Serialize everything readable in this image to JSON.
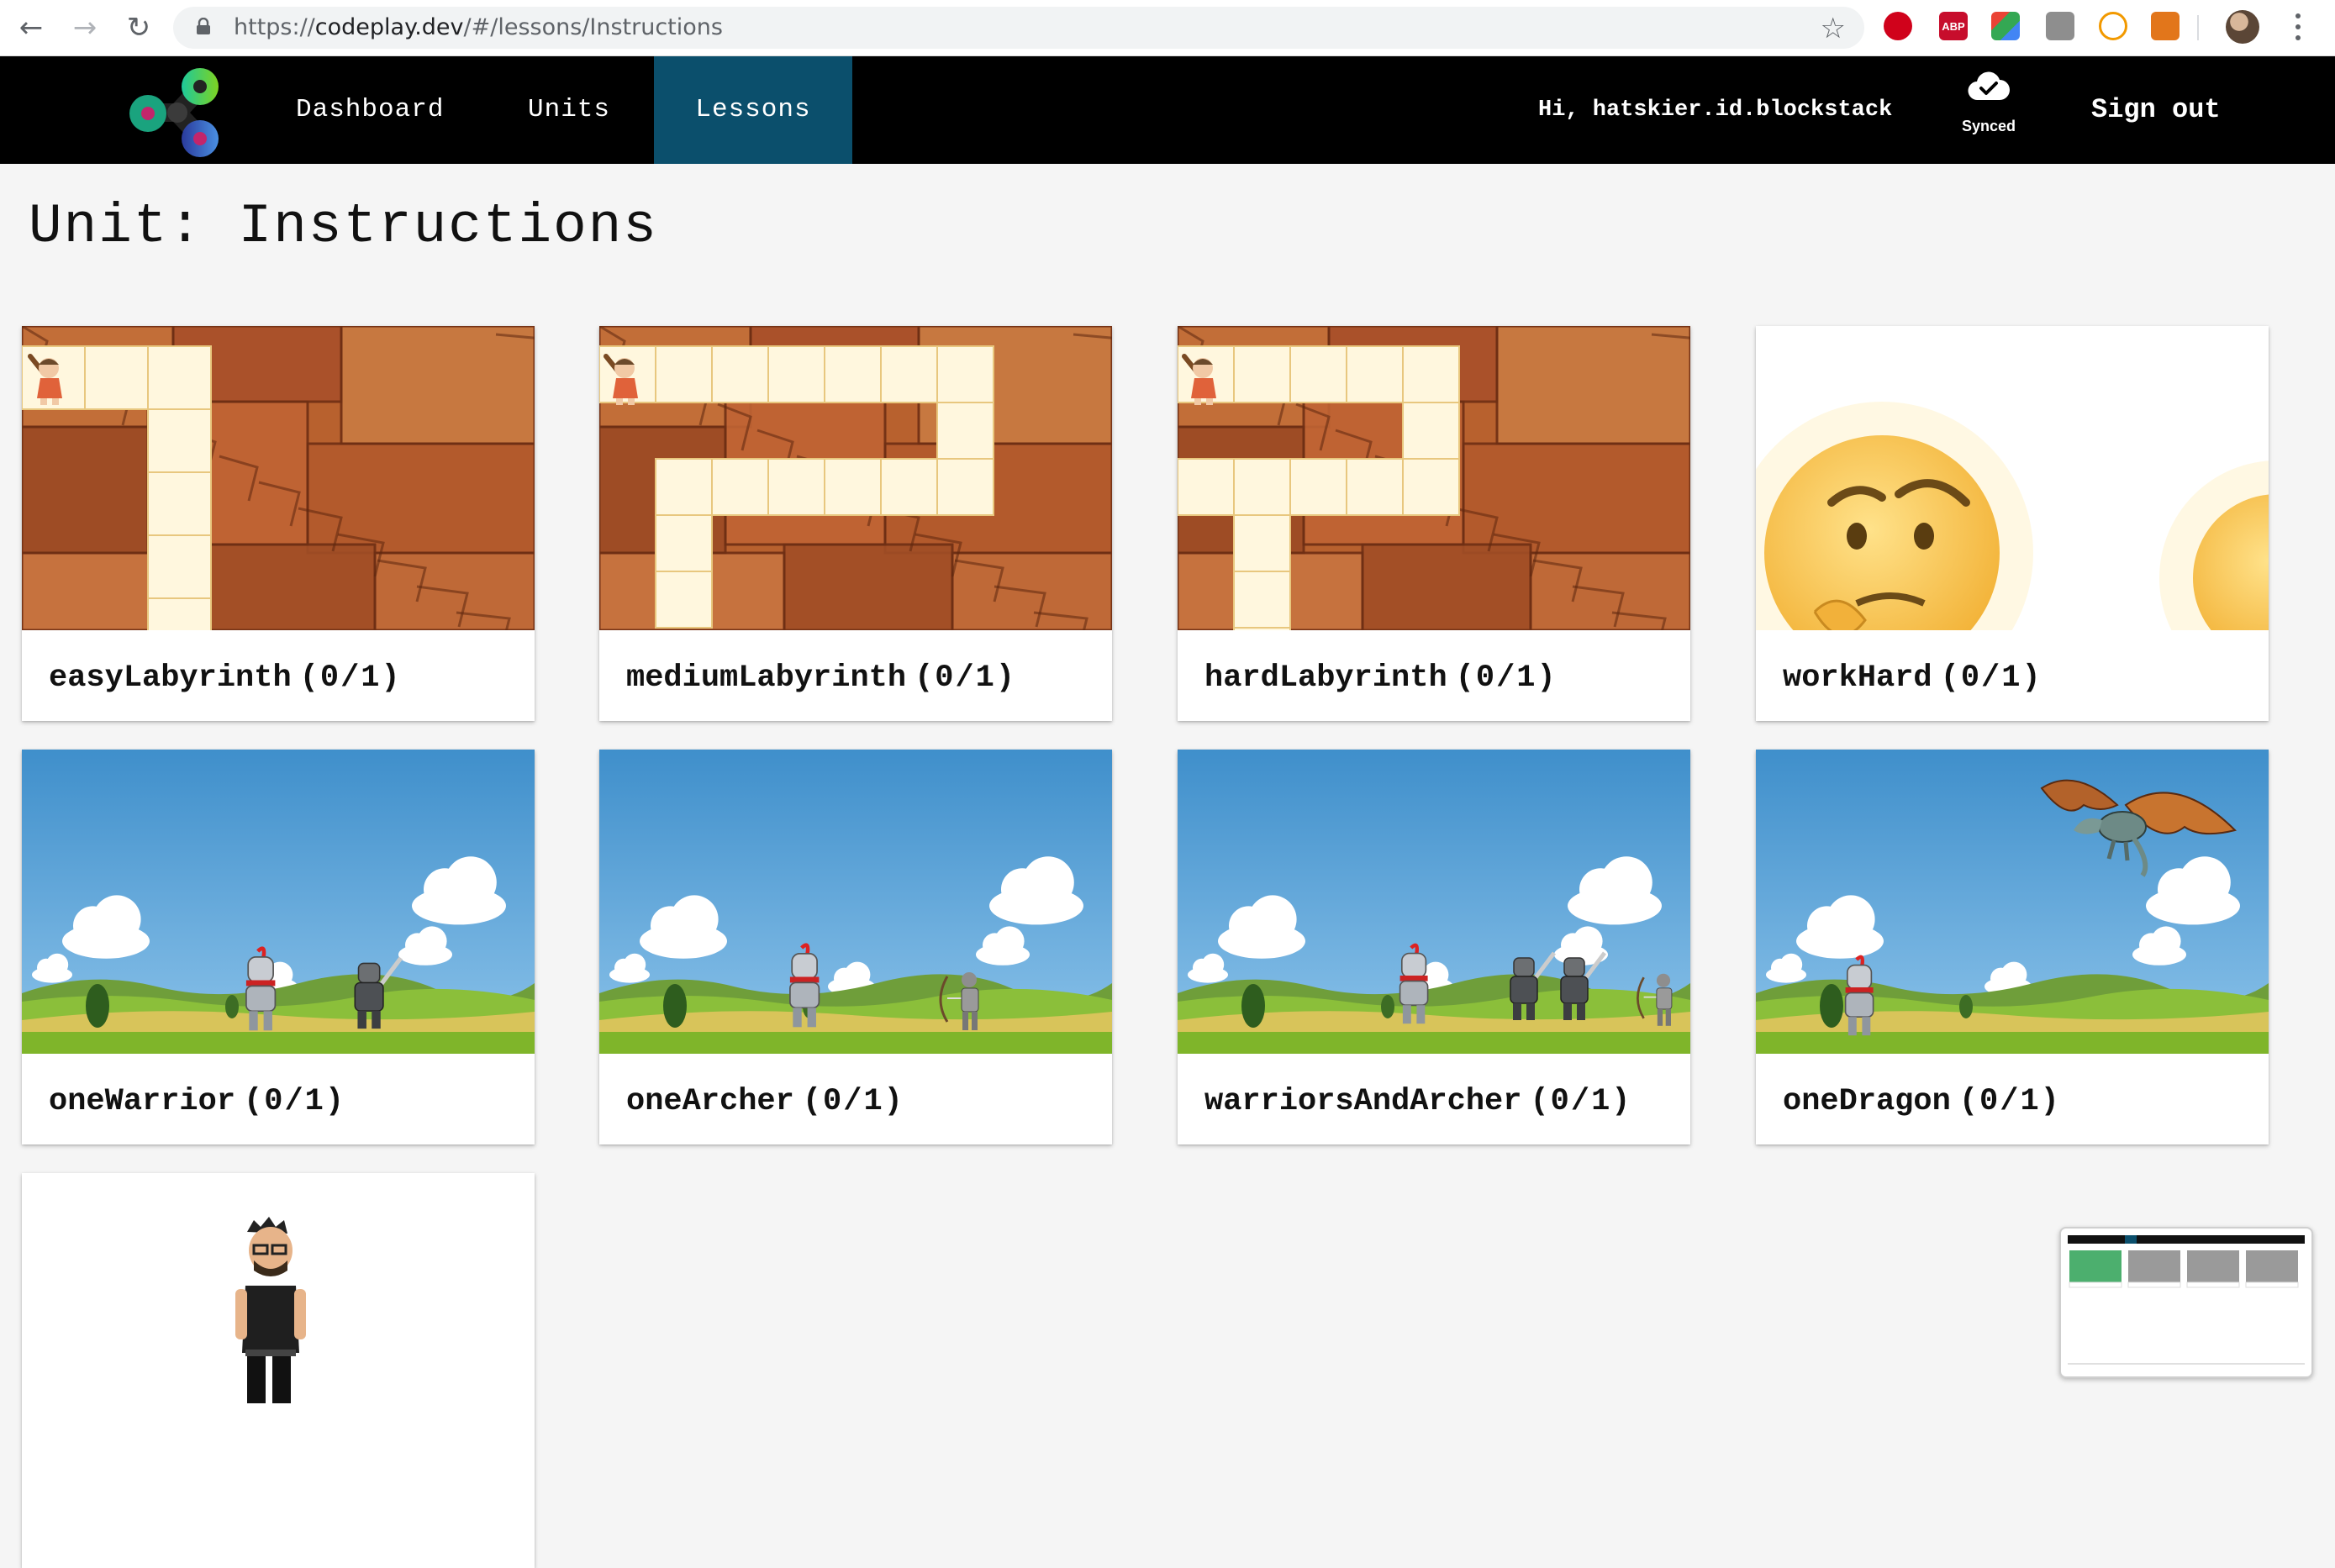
{
  "browser": {
    "url_prefix": "https://",
    "url_host": "codeplay.dev",
    "url_path": "/#/lessons/Instructions",
    "extensions": [
      {
        "name": "ublock-icon",
        "color": "#d0021b",
        "text": ""
      },
      {
        "name": "adblock-plus-icon",
        "color": "#c70d2c",
        "text": "ABP"
      },
      {
        "name": "color-picker-icon",
        "color": "#34a853",
        "text": ""
      },
      {
        "name": "tab-manager-icon",
        "color": "#8e8e8e",
        "text": ""
      },
      {
        "name": "timer-icon",
        "color": "#f29900",
        "text": ""
      },
      {
        "name": "metamask-icon",
        "color": "#e2761b",
        "text": ""
      }
    ]
  },
  "nav": {
    "links": [
      {
        "label": "Dashboard",
        "active": false
      },
      {
        "label": "Units",
        "active": false
      },
      {
        "label": "Lessons",
        "active": true
      }
    ],
    "greeting": "Hi, hatskier.id.blockstack",
    "sync_label": "Synced",
    "signout_label": "Sign out"
  },
  "page": {
    "title": "Unit: Instructions"
  },
  "lessons": [
    {
      "name": "easyLabyrinth",
      "progress": "(0/1)",
      "thumb": "labyrinth-easy"
    },
    {
      "name": "mediumLabyrinth",
      "progress": "(0/1)",
      "thumb": "labyrinth-medium"
    },
    {
      "name": "hardLabyrinth",
      "progress": "(0/1)",
      "thumb": "labyrinth-hard"
    },
    {
      "name": "workHard",
      "progress": "(0/1)",
      "thumb": "thinking-emoji"
    },
    {
      "name": "oneWarrior",
      "progress": "(0/1)",
      "thumb": "meadow-warrior"
    },
    {
      "name": "oneArcher",
      "progress": "(0/1)",
      "thumb": "meadow-archer"
    },
    {
      "name": "warriorsAndArcher",
      "progress": "(0/1)",
      "thumb": "meadow-warriors-archer"
    },
    {
      "name": "oneDragon",
      "progress": "(0/1)",
      "thumb": "meadow-dragon"
    },
    {
      "name": "",
      "progress": "",
      "thumb": "cartoon-person"
    }
  ],
  "colors": {
    "nav_bg": "#000000",
    "nav_active": "#0b4f6c",
    "rock": "#b55a2a",
    "path_tile": "#fff6dc",
    "sky": "#4e9fd6",
    "grass": "#7cb52b"
  }
}
